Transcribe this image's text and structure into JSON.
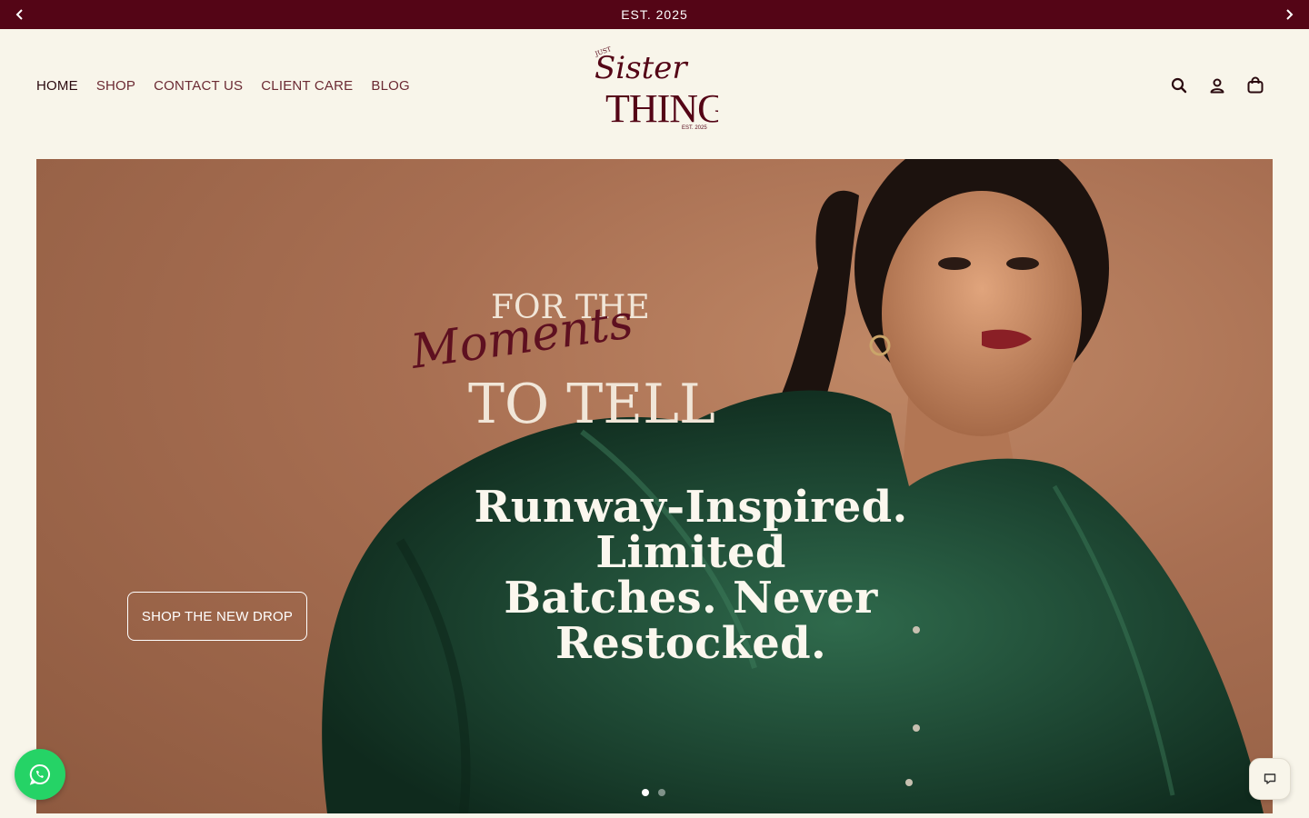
{
  "announcement": {
    "text": "EST. 2025",
    "prev_icon": "chevron-left-icon",
    "next_icon": "chevron-right-icon"
  },
  "nav": {
    "items": [
      {
        "label": "HOME",
        "active": true
      },
      {
        "label": "SHOP"
      },
      {
        "label": "CONTACT US"
      },
      {
        "label": "CLIENT CARE"
      },
      {
        "label": "BLOG"
      }
    ]
  },
  "logo": {
    "small_top": "JUST",
    "script": "Sister",
    "main": "THINGS",
    "est": "EST. 2025"
  },
  "header_icons": [
    "search-icon",
    "account-icon",
    "cart-icon"
  ],
  "hero": {
    "tagline_top": "FOR THE",
    "tagline_script": "Moments",
    "tagline_bottom": "TO TELL",
    "headline_line1": "Runway-Inspired. Limited",
    "headline_line2": "Batches. Never Restocked.",
    "cta_label": "SHOP THE NEW DROP",
    "slide_count": 2,
    "active_slide": 1
  },
  "colors": {
    "brand": "#540516",
    "background": "#f8f5ea",
    "whatsapp": "#25d366",
    "dress": "#1f4a35"
  }
}
